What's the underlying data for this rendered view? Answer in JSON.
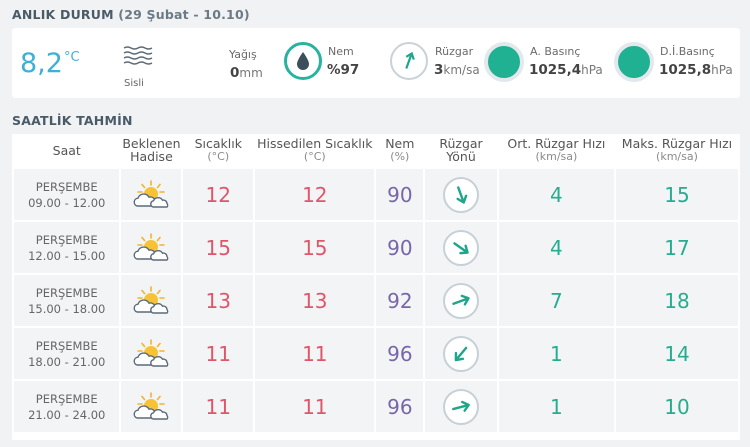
{
  "current": {
    "title": "ANLIK DURUM",
    "subtitle": "(29 Şubat - 10.10)",
    "temperature": "8,2",
    "temperature_unit": "°C",
    "condition": "Sisli",
    "condition_icon": "fog-icon",
    "precip_label": "Yağış",
    "precip_value": "0",
    "precip_unit": "mm",
    "humidity_label": "Nem",
    "humidity_value": "%97",
    "wind_label": "Rüzgar",
    "wind_value": "3",
    "wind_unit": "km/sa",
    "pressure_label": "A. Basınç",
    "pressure_value": "1025,4",
    "pressure_unit": "hPa",
    "sea_pressure_label": "D.İ.Basınç",
    "sea_pressure_value": "1025,8",
    "sea_pressure_unit": "hPa"
  },
  "forecast": {
    "title": "SAATLİK TAHMİN",
    "headers": {
      "time": "Saat",
      "event_line1": "Beklenen",
      "event_line2": "Hadise",
      "temp": "Sıcaklık",
      "temp_unit": "(°C)",
      "feels": "Hissedilen Sıcaklık",
      "feels_unit": "(°C)",
      "humidity": "Nem",
      "humidity_unit": "(%)",
      "wind_dir_line1": "Rüzgar",
      "wind_dir_line2": "Yönü",
      "avg_wind": "Ort. Rüzgar Hızı",
      "avg_wind_unit": "(km/sa)",
      "max_wind": "Maks. Rüzgar Hızı",
      "max_wind_unit": "(km/sa)"
    },
    "rows": [
      {
        "day": "PERŞEMBE",
        "range": "09.00 - 12.00",
        "icon": "partly-cloudy-icon",
        "temp": "12",
        "feels": "12",
        "humidity": "90",
        "wind_dir_deg": 160,
        "avg_wind": "4",
        "max_wind": "15"
      },
      {
        "day": "PERŞEMBE",
        "range": "12.00 - 15.00",
        "icon": "partly-cloudy-icon",
        "temp": "15",
        "feels": "15",
        "humidity": "90",
        "wind_dir_deg": 125,
        "avg_wind": "4",
        "max_wind": "17"
      },
      {
        "day": "PERŞEMBE",
        "range": "15.00 - 18.00",
        "icon": "partly-cloudy-icon",
        "temp": "13",
        "feels": "13",
        "humidity": "92",
        "wind_dir_deg": 70,
        "avg_wind": "7",
        "max_wind": "18"
      },
      {
        "day": "PERŞEMBE",
        "range": "18.00 - 21.00",
        "icon": "partly-cloudy-icon",
        "temp": "11",
        "feels": "11",
        "humidity": "96",
        "wind_dir_deg": 220,
        "avg_wind": "1",
        "max_wind": "14"
      },
      {
        "day": "PERŞEMBE",
        "range": "21.00 - 24.00",
        "icon": "partly-cloudy-icon",
        "temp": "11",
        "feels": "11",
        "humidity": "96",
        "wind_dir_deg": 75,
        "avg_wind": "1",
        "max_wind": "10"
      }
    ]
  },
  "colors": {
    "accent_temp": "#3db0d8",
    "temp_red": "#e0556a",
    "humidity_purple": "#7766a8",
    "wind_green": "#26ad8f"
  }
}
